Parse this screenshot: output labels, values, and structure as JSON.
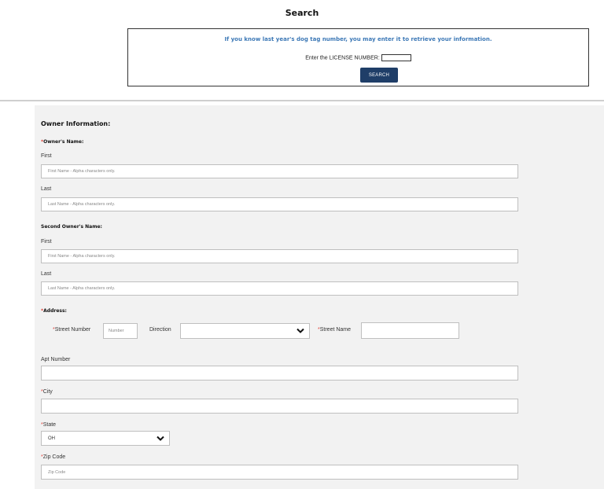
{
  "search": {
    "title": "Search",
    "info": "If you know last year's dog tag number, you may enter it to retrieve your information.",
    "license_label": "Enter the LICENSE NUMBER:",
    "button": "SEARCH"
  },
  "owner": {
    "heading": "Owner Information:",
    "name_label": "Owner's Name:",
    "first_label": "First",
    "first_placeholder": "First Name - Alpha characters only.",
    "last_label": "Last",
    "last_placeholder": "Last Name - Alpha characters only."
  },
  "second_owner": {
    "heading": "Second Owner's Name:",
    "first_label": "First",
    "first_placeholder": "First Name - Alpha characters only.",
    "last_label": "Last",
    "last_placeholder": "Last Name - Alpha characters only."
  },
  "address": {
    "heading": "Address:",
    "street_number_label": "Street Number",
    "street_number_placeholder": "Number",
    "direction_label": "Direction",
    "direction_value": "",
    "street_name_label": "Street Name",
    "apt_label": "Apt Number",
    "city_label": "City",
    "state_label": "State",
    "state_value": "OH",
    "zip_label": "Zip Code",
    "zip_placeholder": "Zip Code"
  },
  "required_marker": "*",
  "colors": {
    "accent": "#1f3e68",
    "info_text": "#3c78b6",
    "required": "#e0453c",
    "panel_bg": "#f2f2f2"
  },
  "icons": {
    "dropdown": "chevron-down-icon"
  }
}
